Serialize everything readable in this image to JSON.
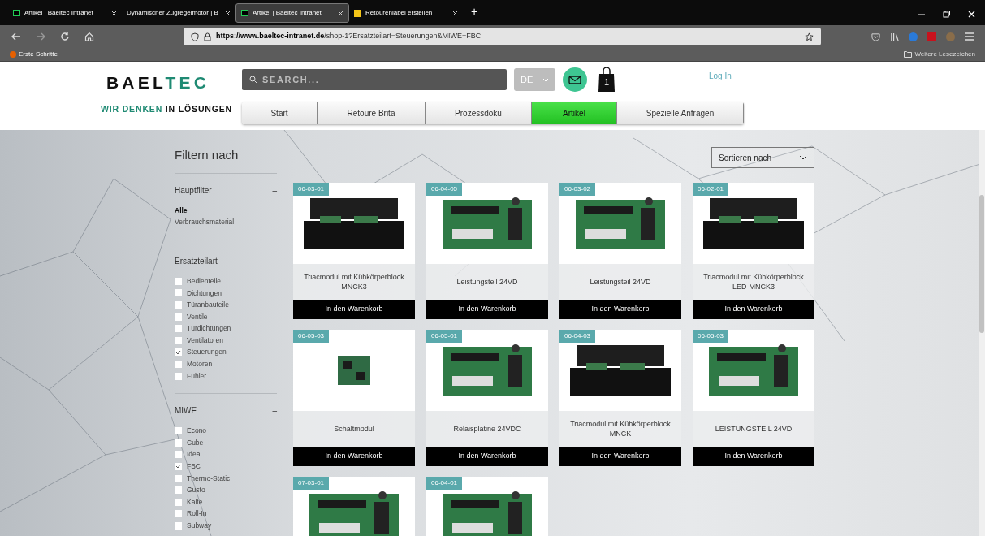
{
  "browser": {
    "tabs": [
      {
        "title": "Artikel | Baeltec Intranet",
        "selected": false,
        "kind": "site"
      },
      {
        "title": "Dynamischer Zugregelmotor | B",
        "selected": false,
        "kind": "plain"
      },
      {
        "title": "Artikel | Baeltec Intranet",
        "selected": true,
        "kind": "site"
      },
      {
        "title": "Retourenlabel erstellen",
        "selected": false,
        "kind": "label"
      }
    ],
    "new_tab": "+",
    "url_host": "https://www.baeltec-intranet.de",
    "url_path": "/shop-1?Ersatzteilart=Steuerungen&MIWE=FBC",
    "bookmarks": [
      "Erste Schritte"
    ],
    "other_bookmarks": "Weitere Lesezeichen"
  },
  "site": {
    "logo": "BAELTEC",
    "tagline": [
      "WIR DENKEN",
      "IN LÖSUNGEN"
    ],
    "search": {
      "placeholder": "SEARCH..."
    },
    "language": "DE",
    "cart_count": "1",
    "login": "Log In",
    "nav": [
      {
        "label": "Start",
        "selected": false
      },
      {
        "label": "Retoure Brita",
        "selected": false
      },
      {
        "label": "Prozessdoku",
        "selected": false
      },
      {
        "label": "Artikel",
        "selected": true
      },
      {
        "label": "Spezielle Anfragen",
        "selected": false
      }
    ]
  },
  "filter": {
    "title": "Filtern nach",
    "sections": [
      {
        "title": "Hauptfilter",
        "collapse": "–",
        "kind": "links",
        "items": [
          {
            "label": "Alle",
            "selected": true
          },
          {
            "label": "Verbrauchsmaterial",
            "selected": false
          }
        ]
      },
      {
        "title": "Ersatzteilart",
        "collapse": "–",
        "kind": "checkboxes",
        "items": [
          {
            "label": "Bedienteile",
            "checked": false
          },
          {
            "label": "Dichtungen",
            "checked": false
          },
          {
            "label": "Türanbauteile",
            "checked": false
          },
          {
            "label": "Ventile",
            "checked": false
          },
          {
            "label": "Türdichtungen",
            "checked": false
          },
          {
            "label": "Ventilatoren",
            "checked": false
          },
          {
            "label": "Steuerungen",
            "checked": true
          },
          {
            "label": "Motoren",
            "checked": false
          },
          {
            "label": "Fühler",
            "checked": false
          }
        ]
      },
      {
        "title": "MIWE",
        "collapse": "–",
        "kind": "checkboxes",
        "items": [
          {
            "label": "Econo",
            "checked": false
          },
          {
            "label": "Cube",
            "checked": false
          },
          {
            "label": "Ideal",
            "checked": false
          },
          {
            "label": "FBC",
            "checked": true
          },
          {
            "label": "Thermo-Static",
            "checked": false
          },
          {
            "label": "Gusto",
            "checked": false
          },
          {
            "label": "Kalte",
            "checked": false
          },
          {
            "label": "Roll-In",
            "checked": false
          },
          {
            "label": "Subway",
            "checked": false
          }
        ]
      }
    ]
  },
  "sort": {
    "label": "Sortieren nach"
  },
  "products": [
    {
      "code": "06-03-01",
      "title": "Triacmodul mit Kühkörperblock MNCK3",
      "button": "In den Warenkorb",
      "kind": "heatsink"
    },
    {
      "code": "06-04-05",
      "title": "Leistungsteil 24VD",
      "button": "In den Warenkorb",
      "kind": "board"
    },
    {
      "code": "06-03-02",
      "title": "Leistungsteil 24VD",
      "button": "In den Warenkorb",
      "kind": "board"
    },
    {
      "code": "06-02-01",
      "title": "Triacmodul mit Kühkörperblock LED-MNCK3",
      "button": "In den Warenkorb",
      "kind": "heatsink"
    },
    {
      "code": "06-05-03",
      "title": "Schaltmodul",
      "button": "In den Warenkorb",
      "kind": "small"
    },
    {
      "code": "06-05-01",
      "title": "Relaisplatine 24VDC",
      "button": "In den Warenkorb",
      "kind": "board"
    },
    {
      "code": "06-04-03",
      "title": "Triacmodul mit Kühkörperblock MNCK",
      "button": "In den Warenkorb",
      "kind": "heatsink"
    },
    {
      "code": "06-05-03",
      "title": "LEISTUNGSTEIL 24VD",
      "button": "In den Warenkorb",
      "kind": "board"
    },
    {
      "code": "07-03-01",
      "kind": "board"
    },
    {
      "code": "06-04-01",
      "kind": "board"
    }
  ]
}
